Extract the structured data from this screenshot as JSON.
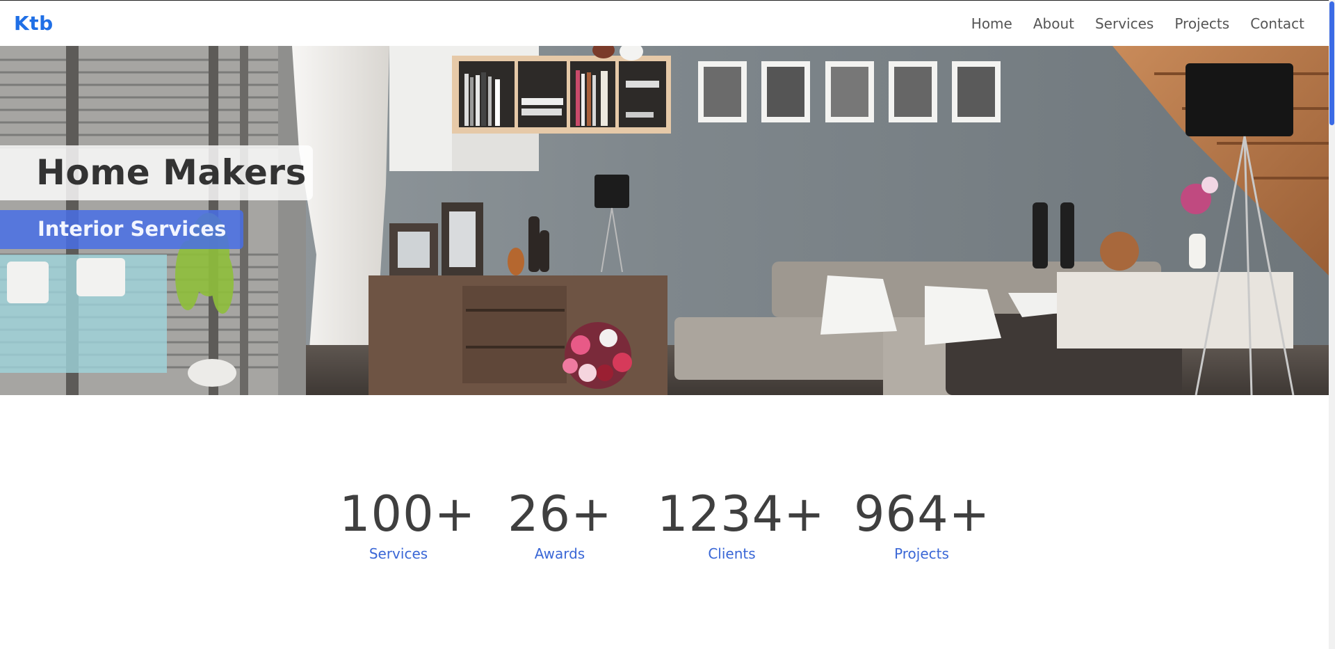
{
  "brand": {
    "name": "Ktb",
    "color": "#1f6fe6"
  },
  "nav": {
    "items": [
      "Home",
      "About",
      "Services",
      "Projects",
      "Contact"
    ]
  },
  "hero": {
    "title": "Home Makers",
    "subtitle": "Interior Services",
    "accent": "#486ee6"
  },
  "stats": [
    {
      "value": "100+",
      "label": "Services"
    },
    {
      "value": "26+",
      "label": "Awards"
    },
    {
      "value": "1234+",
      "label": "Clients"
    },
    {
      "value": "964+",
      "label": "Projects"
    }
  ],
  "colors": {
    "stat_label": "#3a67d6",
    "text": "#3f3f3f",
    "scroll_thumb": "#3b6be6"
  }
}
